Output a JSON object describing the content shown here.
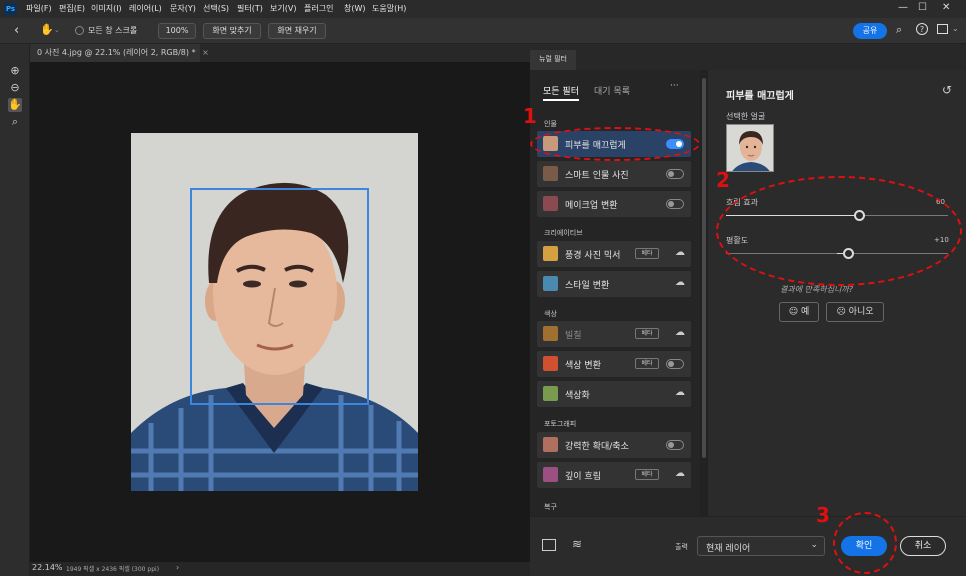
{
  "menubar": {
    "logo": "Ps",
    "items": [
      "파일(F)",
      "편집(E)",
      "이미지(I)",
      "레이어(L)",
      "문자(Y)",
      "선택(S)",
      "필터(T)",
      "보기(V)",
      "플러그인",
      "창(W)",
      "도움말(H)"
    ]
  },
  "options": {
    "scroll_all": "모든 창 스크롤",
    "zoom": "100%",
    "fit_screen": "화면 맞추기",
    "fill_screen": "화면 채우기",
    "share": "공유"
  },
  "document": {
    "tab_title": "0 사진 4.jpg @ 22.1% (레이어 2, RGB/8) *",
    "close": "×"
  },
  "status": {
    "zoom": "22.14%",
    "dims": "1949 픽셀 x 2436 픽셀 (300 ppi)",
    "arrow": "›"
  },
  "neural": {
    "panel_tab": "뉴럴 필터",
    "tab_all": "모든 필터",
    "tab_wait": "대기 목록",
    "more": "···",
    "categories": {
      "portrait": "인물",
      "creative": "크리에이티브",
      "color": "색상",
      "photo": "포토그래피",
      "restore": "복구"
    },
    "filters": [
      {
        "label": "피부를 매끄럽게",
        "toggle": "on",
        "beta": "",
        "cloud": false,
        "dim": false,
        "icon": "face-icon",
        "color": "#c89a7a"
      },
      {
        "label": "스마트 인물 사진",
        "toggle": "off",
        "beta": "",
        "cloud": false,
        "dim": false,
        "icon": "portrait-icon",
        "color": "#7a5a48"
      },
      {
        "label": "메이크업 변환",
        "toggle": "off",
        "beta": "",
        "cloud": false,
        "dim": false,
        "icon": "makeup-icon",
        "color": "#8a4a50"
      },
      {
        "label": "풍경 사진 믹서",
        "toggle": "",
        "beta": "베타",
        "cloud": true,
        "dim": false,
        "icon": "landscape-icon",
        "color": "#d4a040"
      },
      {
        "label": "스타일 변환",
        "toggle": "",
        "beta": "",
        "cloud": true,
        "dim": false,
        "icon": "style-icon",
        "color": "#4a8ab0"
      },
      {
        "label": "빌칠",
        "toggle": "",
        "beta": "베타",
        "cloud": true,
        "dim": true,
        "icon": "colorize-icon",
        "color": "#a07030"
      },
      {
        "label": "색상 변환",
        "toggle": "off",
        "beta": "베타",
        "cloud": false,
        "dim": false,
        "icon": "color-transfer-icon",
        "color": "#d05030"
      },
      {
        "label": "색상화",
        "toggle": "",
        "beta": "",
        "cloud": true,
        "dim": false,
        "icon": "colorize-icon",
        "color": "#7a9a50"
      },
      {
        "label": "강력한 확대/축소",
        "toggle": "off",
        "beta": "",
        "cloud": false,
        "dim": false,
        "icon": "zoom-icon",
        "color": "#b07060"
      },
      {
        "label": "깊이 흐림",
        "toggle": "",
        "beta": "베타",
        "cloud": true,
        "dim": false,
        "icon": "depth-blur-icon",
        "color": "#9a5080"
      }
    ],
    "detail": {
      "title": "피부를 매끄럽게",
      "face_label": "선택한 얼굴",
      "blur_label": "흐림 효과",
      "blur_value": "60",
      "blur_level": 0.6,
      "smooth_label": "평활도",
      "smooth_value": "+10",
      "smooth_level": 0.55,
      "feedback": "결과에 만족하십니까?",
      "yes": "예",
      "no": "아니오"
    },
    "bottom": {
      "output_label": "출력",
      "output_value": "현재 레이어",
      "ok": "확인",
      "cancel": "취소"
    }
  },
  "annotations": {
    "n1": "1",
    "n2": "2",
    "n3": "3"
  }
}
